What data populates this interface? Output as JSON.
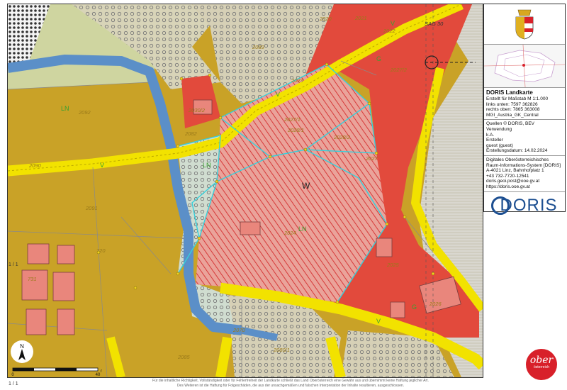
{
  "panel": {
    "title": "DORIS Landkarte",
    "scale": "Erstellt für Maßstab M 1:1.000",
    "links_unten": "links unten: 7597 362826",
    "rechts_oben": "rechts oben: 7865 363008",
    "crs": "MGI_Austria_GK_Central",
    "quellen": "Quellen © DORIS, BEV",
    "verwendung": "Verwendung",
    "verwendung_val": "k.A.",
    "ersteller": "Ersteller",
    "ersteller_val": "guest (guest)",
    "datum": "Erstellungsdatum: 14.02.2024",
    "org1": "Digitales Oberösterreichisches",
    "org2": "Raum-Informations-System [DORIS]",
    "addr": "A-4021 Linz, Bahnhofplatz 1",
    "tel": "+43 732-7720-12541",
    "email": "doris.geoi.post@ooe.gv.at",
    "web": "https://doris.ooe.gv.at",
    "logo": "DORIS"
  },
  "brand": {
    "line1": "ober",
    "line2": "österreich"
  },
  "page": "1 / 1",
  "pagelabel": "1 / 1",
  "disclaimer": {
    "line1": "Für die inhaltliche Richtigkeit, Vollständigkeit oder für Fehlerfreiheit der Landkarte schließt das Land Oberösterreich eine Gewähr aus und übernimmt keine Haftung jeglicher Art.",
    "line2": "Des Weiteren ist die Haftung für Folgeschäden, die aus der unsachgemäßen und falschen Interpretation der Inhalte resultieren, ausgeschlossen."
  },
  "scale": {
    "start": "0",
    "end": "40",
    "unit": "m"
  },
  "north": "N",
  "map": {
    "zone_w": "W",
    "labels": {
      "ln1": "LN",
      "ln2": "LN",
      "ln3": "LN",
      "v1": "V",
      "v2": "V",
      "v3": "V",
      "v4": "V",
      "g1": "G",
      "g2": "G",
      "p2028_1": "2028/1",
      "p2027_1": "2027/1",
      "p2027_2": "2027/2",
      "p2030_2": "2030/2",
      "p2028_2": "2028/2",
      "p2027": "2027",
      "p2024": "2024",
      "p2025": "2025",
      "p2026": "2026",
      "p2091": "2091",
      "p2022": "2022",
      "p2023": "2023",
      "p2021": "2021",
      "p2080_1": "2080/1",
      "p2085": "2085",
      "p2090": "2090",
      "p2089": "2089",
      "p2070": "2070",
      "p2092": "2092",
      "p2082": "2082",
      "p2020": "2020",
      "p731": "731",
      "p720": "720",
      "sag": "SAG 30"
    }
  }
}
